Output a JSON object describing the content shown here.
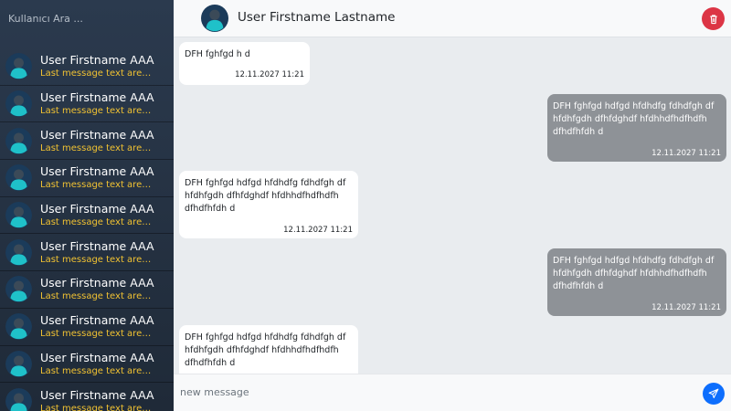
{
  "sidebar": {
    "search_placeholder": "Kullanıcı Ara ...",
    "contacts": [
      {
        "name": "User Firstname AAA",
        "last_message": "Last message text areasf..."
      },
      {
        "name": "User Firstname AAA",
        "last_message": "Last message text areasf..."
      },
      {
        "name": "User Firstname AAA",
        "last_message": "Last message text areasf..."
      },
      {
        "name": "User Firstname AAA",
        "last_message": "Last message text areasf..."
      },
      {
        "name": "User Firstname AAA",
        "last_message": "Last message text areasf..."
      },
      {
        "name": "User Firstname AAA",
        "last_message": "Last message text areasf..."
      },
      {
        "name": "User Firstname AAA",
        "last_message": "Last message text areasf..."
      },
      {
        "name": "User Firstname AAA",
        "last_message": "Last message text areasf..."
      },
      {
        "name": "User Firstname AAA",
        "last_message": "Last message text areasf..."
      },
      {
        "name": "User Firstname AAA",
        "last_message": "Last message text areasf..."
      }
    ]
  },
  "header": {
    "title": "User Firstname Lastname",
    "delete_icon": "trash-icon"
  },
  "messages": [
    {
      "direction": "in",
      "text": "DFH fghfgd h d",
      "time": "12.11.2027 11:21"
    },
    {
      "direction": "out",
      "text": "DFH fghfgd hdfgd hfdhdfg fdhdfgh df hfdhfgdh dfhfdghdf hfdhhdfhdfhdfh dfhdfhfdh d",
      "time": "12.11.2027 11:21"
    },
    {
      "direction": "in",
      "text": "DFH fghfgd hdfgd hfdhdfg fdhdfgh df hfdhfgdh dfhfdghdf hfdhhdfhdfhdfh dfhdfhfdh d",
      "time": "12.11.2027 11:21"
    },
    {
      "direction": "out",
      "text": "DFH fghfgd hdfgd hfdhdfg fdhdfgh df hfdhfgdh dfhfdghdf hfdhhdfhdfhdfh dfhdfhfdh d",
      "time": "12.11.2027 11:21"
    },
    {
      "direction": "in",
      "text": "DFH fghfgd hdfgd hfdhdfg fdhdfgh df hfdhfgdh dfhfdghdf hfdhhdfhdfhdfh dfhdfhfdh d",
      "time": ""
    }
  ],
  "composer": {
    "placeholder": "new message",
    "send_icon": "send-icon"
  },
  "colors": {
    "sidebar_bg": "#2b3a4e",
    "last_message": "#f1c232",
    "outgoing_bubble": "#8e9297",
    "delete": "#dc3545",
    "send": "#0d6efd"
  }
}
